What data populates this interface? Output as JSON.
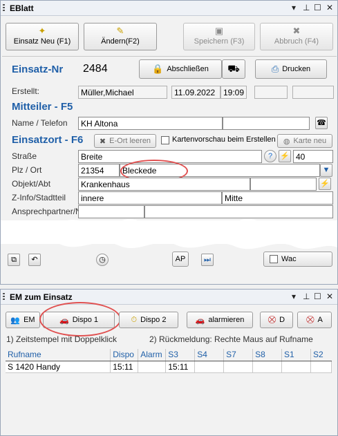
{
  "eblatt": {
    "title": "EBlatt",
    "window_controls": {
      "menu": "▾",
      "pin": "⊥",
      "maximize": "☐",
      "close": "✕"
    },
    "toolbar": [
      {
        "label": "Einsatz Neu (F1)",
        "icon": "new-star-icon",
        "glyph": "✦",
        "enabled": true
      },
      {
        "label": "Ändern(F2)",
        "icon": "edit-pencil-icon",
        "glyph": "✎",
        "enabled": true
      },
      {
        "label": "Speichern (F3)",
        "icon": "save-disk-icon",
        "glyph": "▣",
        "enabled": false
      },
      {
        "label": "Abbruch (F4)",
        "icon": "cancel-x-icon",
        "glyph": "✖",
        "enabled": false
      }
    ],
    "einsatz_nr_label": "Einsatz-Nr",
    "einsatz_nr": "2484",
    "abschliessen_label": "Abschließen",
    "drucken_label": "Drucken",
    "erstellt_label": "Erstellt:",
    "erstellt_by": "Müller,Michael",
    "erstellt_date": "11.09.2022",
    "erstellt_time": "19:09",
    "mitteiler_header": "Mitteiler  -  F5",
    "name_telefon_label": "Name / Telefon",
    "name_telefon_value": "KH Altona",
    "einsatzort_header": "Einsatzort - F6",
    "e_ort_leeren_label": "E-Ort leeren",
    "kartenvorschau_label": "Kartenvorschau beim Erstellen",
    "karte_neu_label": "Karte neu",
    "strasse_label": "Straße",
    "strasse_value": "Breite",
    "hausnr_value": "40",
    "plz_ort_label": "Plz / Ort",
    "plz_value": "21354",
    "ort_value": "Bleckede",
    "objekt_label": "Objekt/Abt",
    "objekt_value": "Krankenhaus",
    "zinfo_label": "Z-Info/Stadtteil",
    "zinfo_value": "innere",
    "stadtteil_value": "Mitte",
    "partial_label": "Ansprechpartner/Name",
    "bottom_ap": "AP",
    "bottom_wac": "Wac"
  },
  "em": {
    "title": "EM zum Einsatz",
    "buttons": [
      {
        "label": "EM",
        "icon": "people-icon"
      },
      {
        "label": "Dispo 1",
        "icon": "car-icon"
      },
      {
        "label": "Dispo 2",
        "icon": "timer-icon"
      },
      {
        "label": "alarmieren",
        "icon": "car-red-icon"
      },
      {
        "label": "D",
        "icon": "car-crossed-icon"
      },
      {
        "label": "A",
        "icon": "car-crossed-red-icon"
      }
    ],
    "hint1": "1) Zeitstempel mit Doppelklick",
    "hint2": "2) Rückmeldung:  Rechte Maus auf Rufname",
    "columns": [
      "Rufname",
      "Dispo",
      "Alarm",
      "S3",
      "S4",
      "S7",
      "S8",
      "S1",
      "S2"
    ],
    "rows": [
      [
        "S 1420 Handy",
        "15:11",
        "",
        "15:11",
        "",
        "",
        "",
        "",
        ""
      ]
    ]
  }
}
